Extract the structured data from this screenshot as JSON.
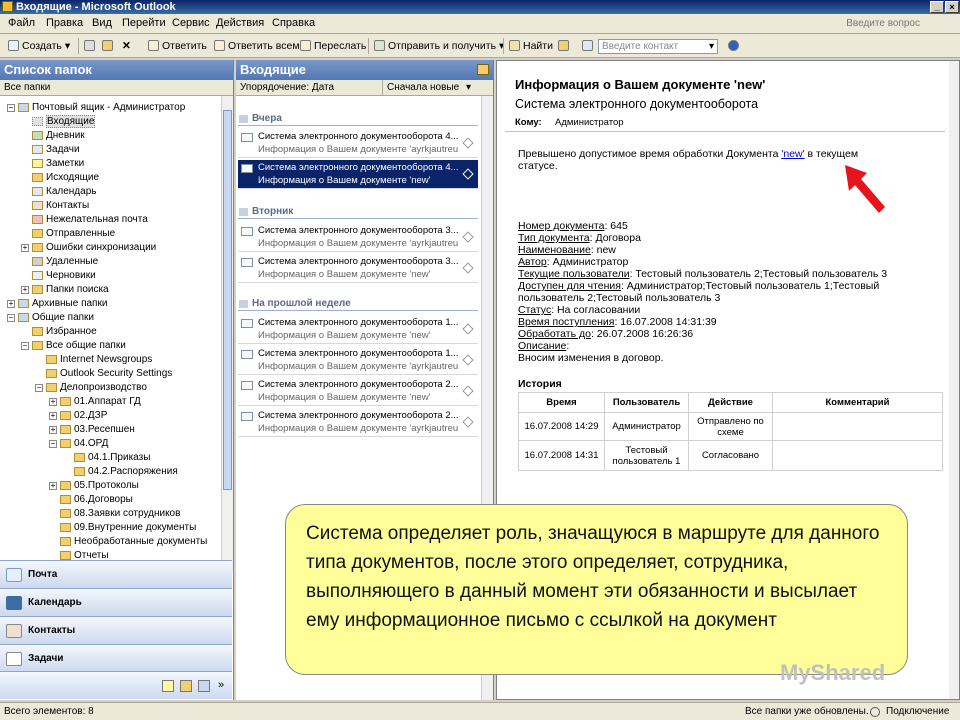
{
  "window": {
    "title": "Входящие - Microsoft Outlook"
  },
  "menu": {
    "items": [
      "Файл",
      "Правка",
      "Вид",
      "Перейти",
      "Сервис",
      "Действия",
      "Справка"
    ],
    "ask_placeholder": "Введите вопрос"
  },
  "toolbar": {
    "create": "Создать",
    "reply": "Ответить",
    "reply_all": "Ответить всем",
    "forward": "Переслать",
    "send_receive": "Отправить и получить",
    "find": "Найти",
    "contact_placeholder": "Введите контакт"
  },
  "folders": {
    "title": "Список папок",
    "all_folders": "Все папки",
    "items": [
      "Почтовый ящик - Администратор",
      "Входящие",
      "Дневник",
      "Задачи",
      "Заметки",
      "Исходящие",
      "Календарь",
      "Контакты",
      "Нежелательная почта",
      "Отправленные",
      "Ошибки синхронизации",
      "Удаленные",
      "Черновики",
      "Папки поиска",
      "Архивные папки",
      "Общие папки",
      "Избранное",
      "Все общие папки",
      "Internet Newsgroups",
      "Outlook Security Settings",
      "Делопроизводство",
      "01.Аппарат ГД",
      "02.ДЗР",
      "03.Ресепшен",
      "04.ОРД",
      "04.1.Приказы",
      "04.2.Распоряжения",
      "05.Протоколы",
      "06.Договоры",
      "08.Заявки сотрудников",
      "09.Внутренние документы",
      "Необработанные документы",
      "Отчеты"
    ]
  },
  "nav": {
    "mail": "Почта",
    "calendar": "Календарь",
    "contacts": "Контакты",
    "tasks": "Задачи"
  },
  "list": {
    "title": "Входящие",
    "arrange": "Упорядочение: Дата",
    "order": "Сначала новые",
    "groups": [
      "Вчера",
      "Вторник",
      "На прошлой неделе"
    ],
    "messages": [
      {
        "from": "Система электронного документооборота 4...",
        "subject": "Информация о Вашем документе 'ayrkjautreu'"
      },
      {
        "from": "Система электронного документооборота 4...",
        "subject": "Информация о Вашем документе 'new'"
      },
      {
        "from": "Система электронного документооборота 3...",
        "subject": "Информация о Вашем документе 'ayrkjautreu'"
      },
      {
        "from": "Система электронного документооборота 3...",
        "subject": "Информация о Вашем документе 'new'"
      },
      {
        "from": "Система электронного документооборота 1...",
        "subject": "Информация о Вашем документе 'new'"
      },
      {
        "from": "Система электронного документооборота 1...",
        "subject": "Информация о Вашем документе 'ayrkjautreu'"
      },
      {
        "from": "Система электронного документооборота 2...",
        "subject": "Информация о Вашем документе 'new'"
      },
      {
        "from": "Система электронного документооборота 2...",
        "subject": "Информация о Вашем документе 'ayrkjautreu'"
      }
    ]
  },
  "reading": {
    "title": "Информация о Вашем документе 'new'",
    "from": "Система электронного документооборота",
    "to_label": "Кому:",
    "to": "Администратор",
    "body_1a": "Превышено допустимое время обработки Документа ",
    "body_link": "'new'",
    "body_1b": " в текущем",
    "body_2": "статусе.",
    "fields": [
      {
        "label": "Номер документа",
        "value": ": 645"
      },
      {
        "label": "Тип документа",
        "value": ": Договора"
      },
      {
        "label": "Наименование",
        "value": ": new"
      },
      {
        "label": "Автор",
        "value": ": Администратор"
      },
      {
        "label": "Текущие пользователи",
        "value": ": Тестовый пользователь 2;Тестовый пользователь 3"
      },
      {
        "label": "Доступен для чтения",
        "value": ": Администратор;Тестовый пользователь 1;Тестовый"
      },
      {
        "label": "",
        "value": "пользователь 2;Тестовый пользователь 3"
      },
      {
        "label": "Статус",
        "value": ": На согласовании"
      },
      {
        "label": "Время поступления",
        "value": ": 16.07.2008 14:31:39"
      },
      {
        "label": "Обработать до",
        "value": ": 26.07.2008 16:26:36"
      },
      {
        "label": "Описание",
        "value": ":"
      },
      {
        "label": "",
        "value": "Вносим изменения в договор."
      }
    ],
    "history_title": "История",
    "history_headers": [
      "Время",
      "Пользователь",
      "Действие",
      "Комментарий"
    ],
    "history_rows": [
      [
        "16.07.2008 14:29",
        "Администратор",
        "Отправлено по схеме",
        ""
      ],
      [
        "16.07.2008 14:31",
        "Тестовый пользователь 1",
        "Согласовано",
        ""
      ]
    ]
  },
  "callout": {
    "text": "Система определяет роль, значащуюся в маршруте для данного типа документов, после этого определяет, сотрудника, выполняющего в данный момент эти обязанности и высылает ему информационное письмо с ссылкой на документ"
  },
  "watermark": "MyShared",
  "status": {
    "count": "Всего элементов: 8",
    "updated": "Все папки уже обновлены.",
    "connection": "Подключение"
  }
}
